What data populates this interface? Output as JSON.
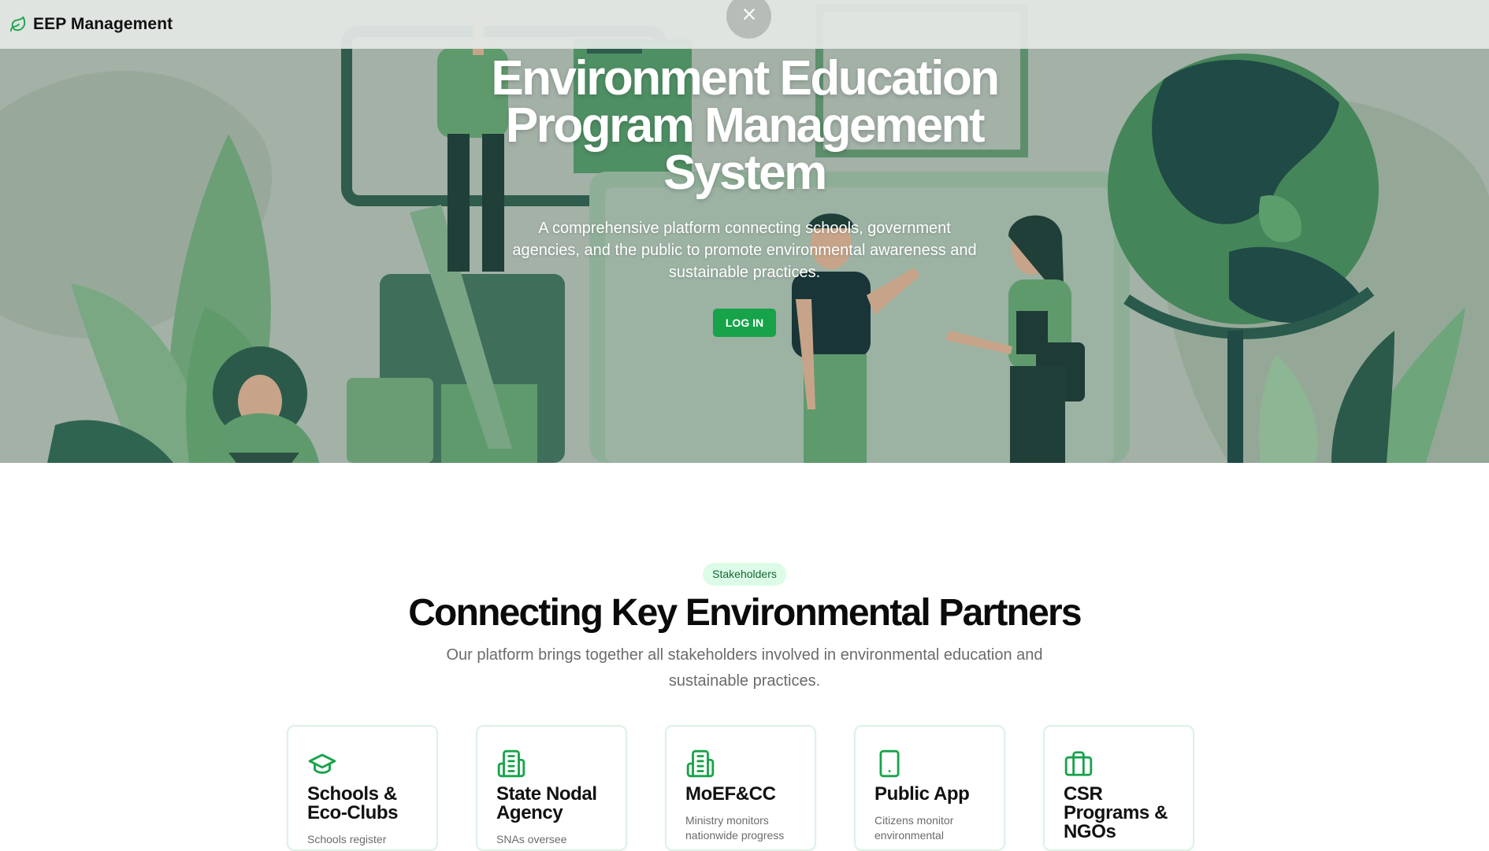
{
  "brand": {
    "name": "EEP Management",
    "icon": "leaf-icon"
  },
  "overlay": {
    "close_icon": "close-icon"
  },
  "hero": {
    "title": "Environment Education Program Management System",
    "subtitle": "A comprehensive platform connecting schools, government agencies, and the public to promote environmental awareness and sustainable practices.",
    "login_label": "LOG IN"
  },
  "stakeholders": {
    "badge": "Stakeholders",
    "title": "Connecting Key Environmental Partners",
    "subtitle": "Our platform brings together all stakeholders involved in environmental education and sustainable practices.",
    "cards": [
      {
        "title": "Schools & Eco-Clubs",
        "desc": "Schools register",
        "icon": "graduation-cap-icon"
      },
      {
        "title": "State Nodal Agency",
        "desc": "SNAs oversee",
        "icon": "building-icon"
      },
      {
        "title": "MoEF&CC",
        "desc": "Ministry monitors nationwide progress",
        "icon": "building-icon"
      },
      {
        "title": "Public App",
        "desc": "Citizens monitor environmental",
        "icon": "smartphone-icon"
      },
      {
        "title": "CSR Programs & NGOs",
        "desc": "",
        "icon": "briefcase-icon"
      }
    ]
  },
  "colors": {
    "accent": "#17a34a",
    "badge_bg": "#dcfce7",
    "badge_text": "#166534",
    "card_border": "#dcf2e5"
  }
}
